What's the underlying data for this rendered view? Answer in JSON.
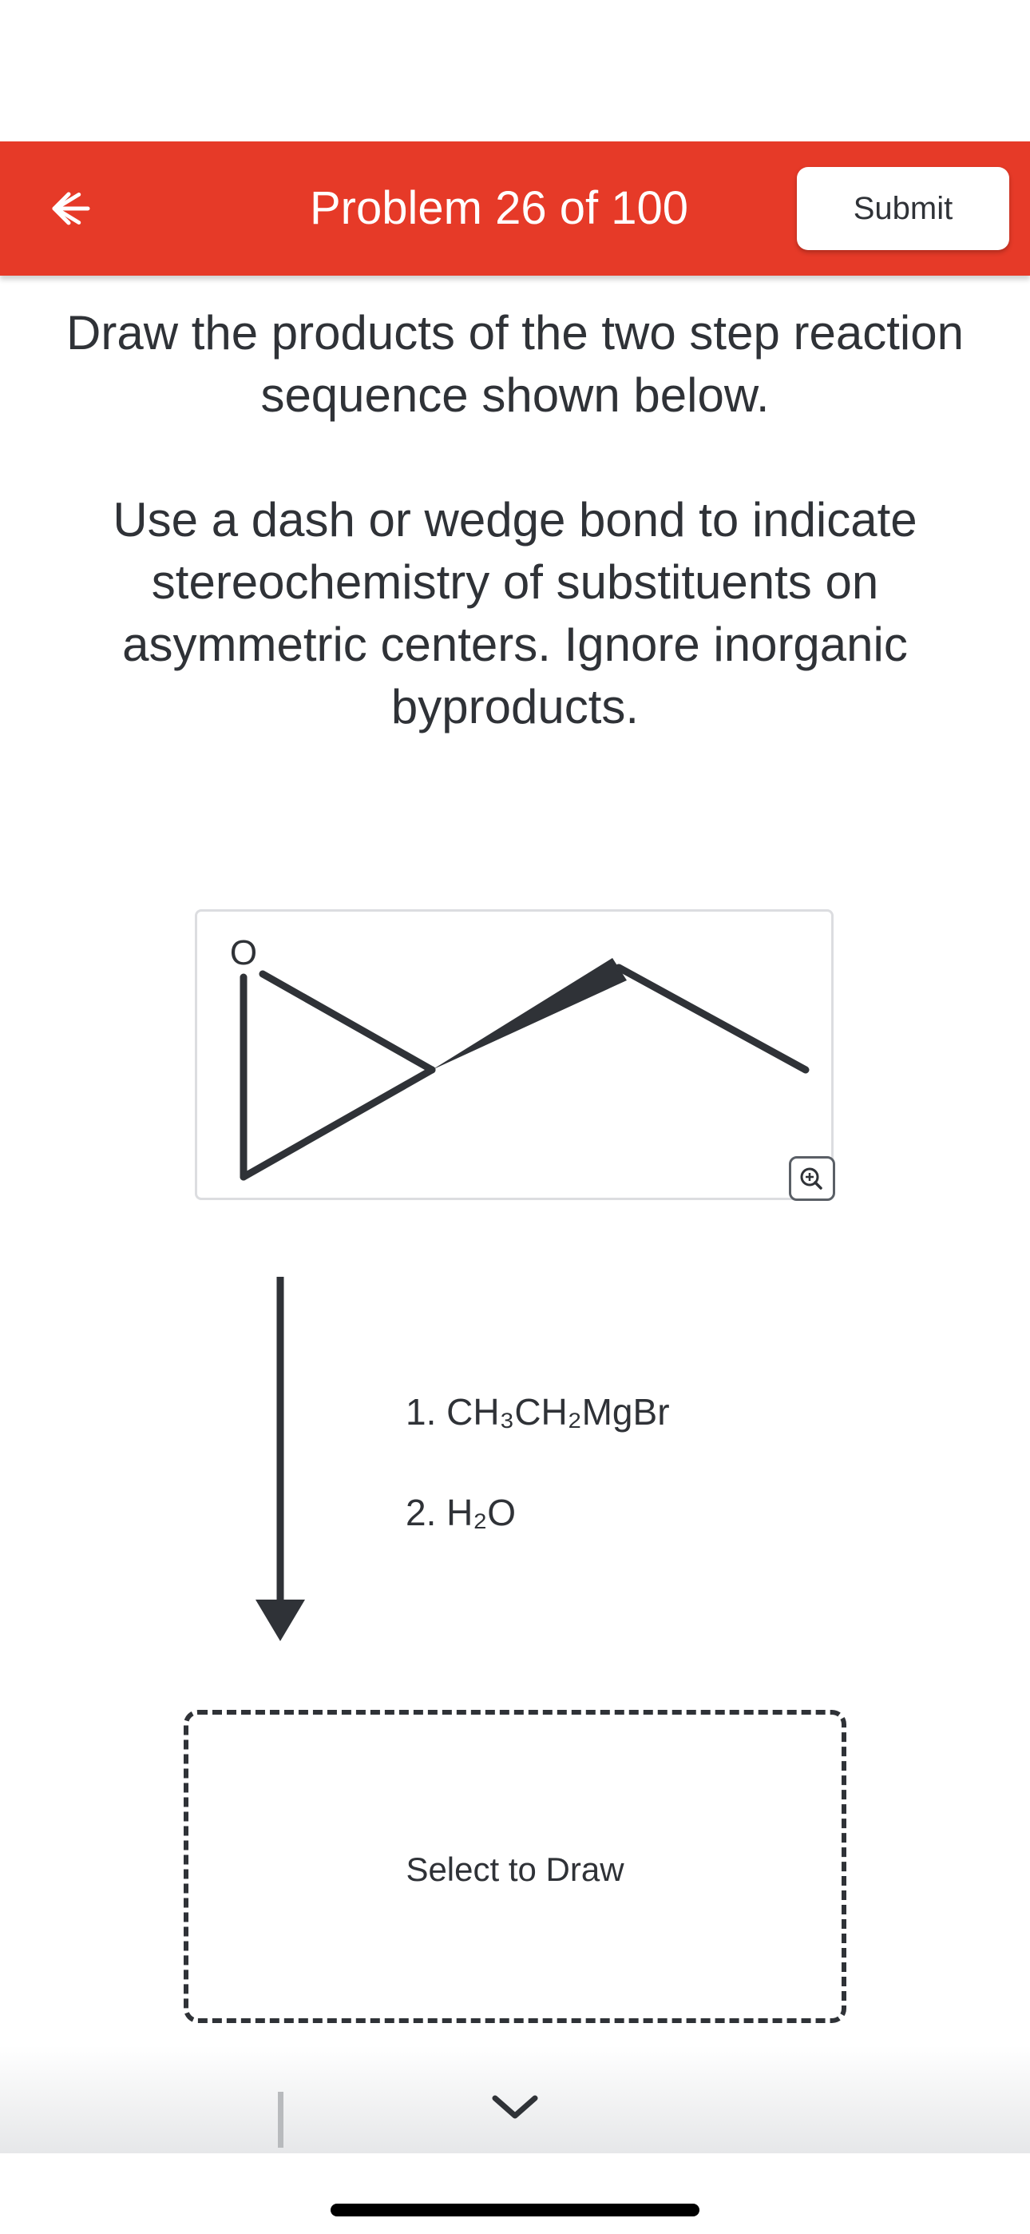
{
  "header": {
    "title": "Problem 26 of 100",
    "submit_label": "Submit",
    "back_icon": "arrow-left-icon",
    "background_color": "#e63a28"
  },
  "instructions": {
    "line1": "Draw the products of the two step reaction sequence shown below.",
    "line2": "Use a dash or wedge bond to indicate stereochemistry of substituents on asymmetric centers. Ignore inorganic byproducts."
  },
  "molecule": {
    "atom_label": "O",
    "zoom_icon": "zoom-in-icon"
  },
  "reaction": {
    "step1": "1. CH₃CH₂MgBr",
    "step2": "2. H₂O"
  },
  "answer": {
    "prompt": "Select to Draw"
  },
  "footer": {
    "chevron_icon": "chevron-down-icon"
  }
}
